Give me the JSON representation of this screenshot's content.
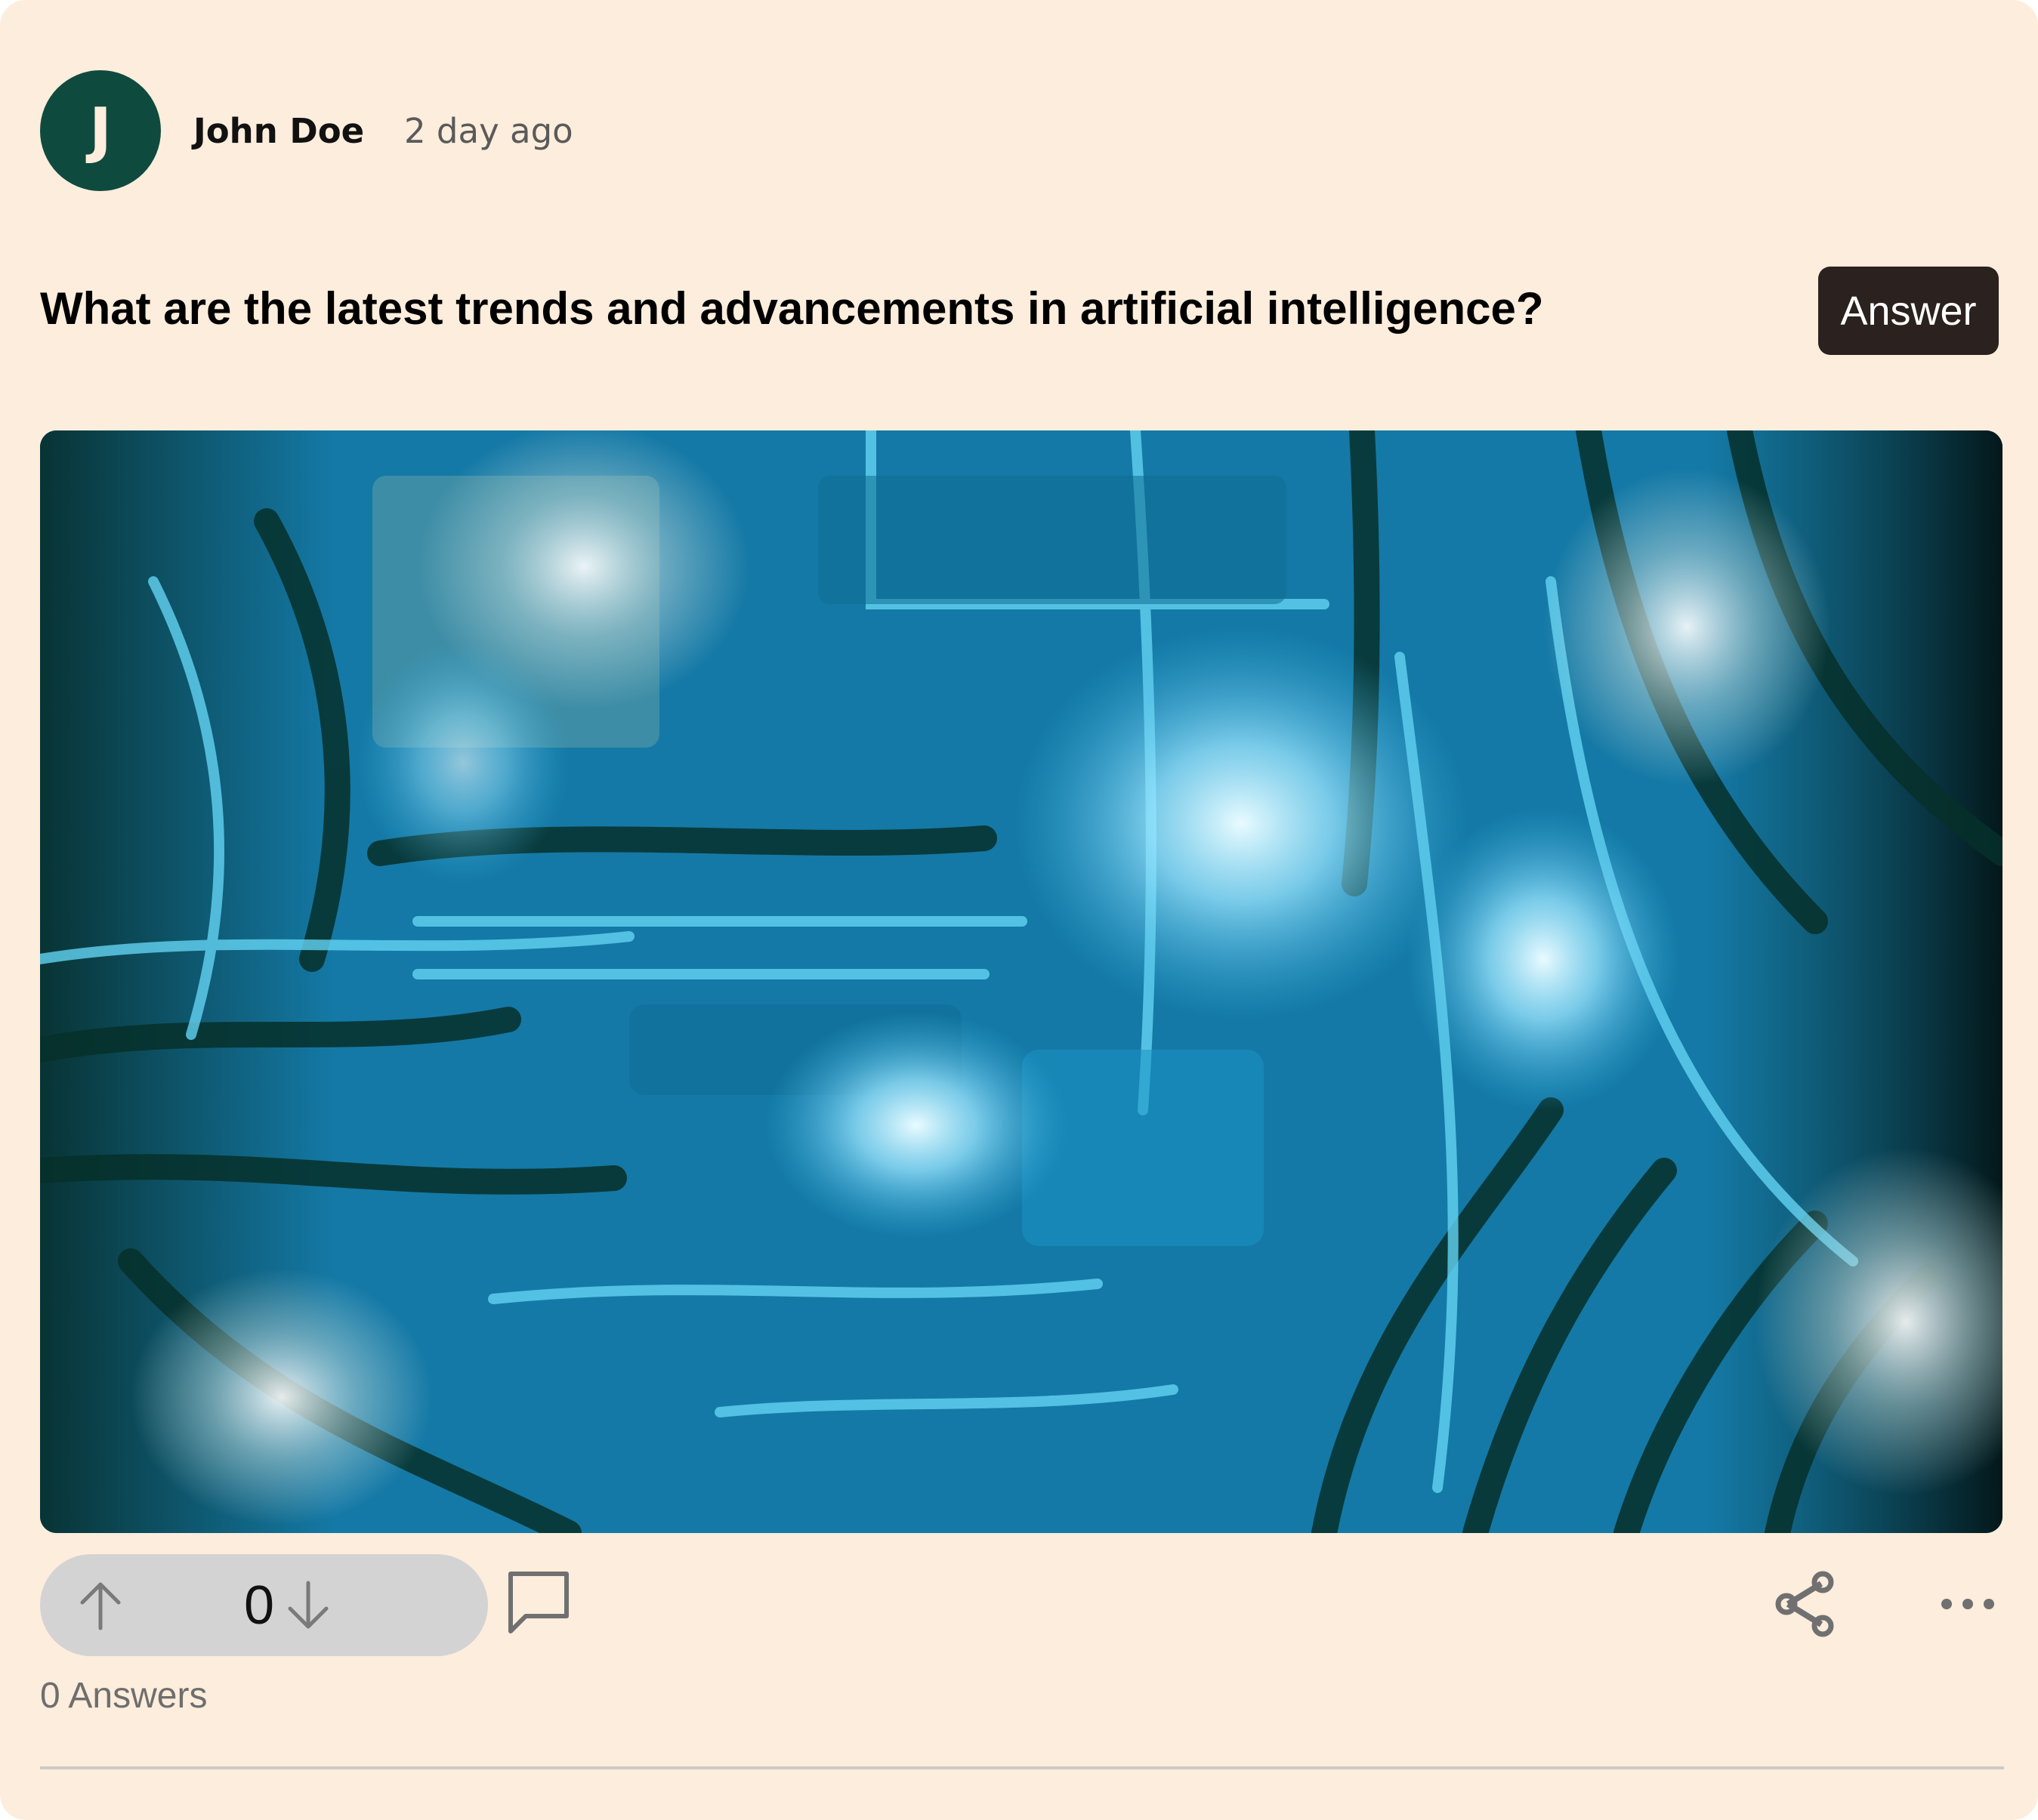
{
  "post": {
    "avatar_initial": "J",
    "author": "John Doe",
    "time": "2 day ago",
    "question": "What are the latest trends and advancements in artificial intelligence?",
    "answer_button": "Answer",
    "image_alt": "abstract blue circuit artwork",
    "votes": "0",
    "answers_label": "0 Answers"
  },
  "icons": {
    "upvote": "arrow-up-icon",
    "downvote": "arrow-down-icon",
    "comment": "speech-bubble-icon",
    "share": "share-icon",
    "more": "ellipsis-icon"
  },
  "colors": {
    "card_background": "#fdeddc",
    "avatar": "#0f4a3f",
    "answer_button": "#2b211e",
    "vote_pill": "#d3d3d3",
    "icon_gray": "#707070"
  }
}
